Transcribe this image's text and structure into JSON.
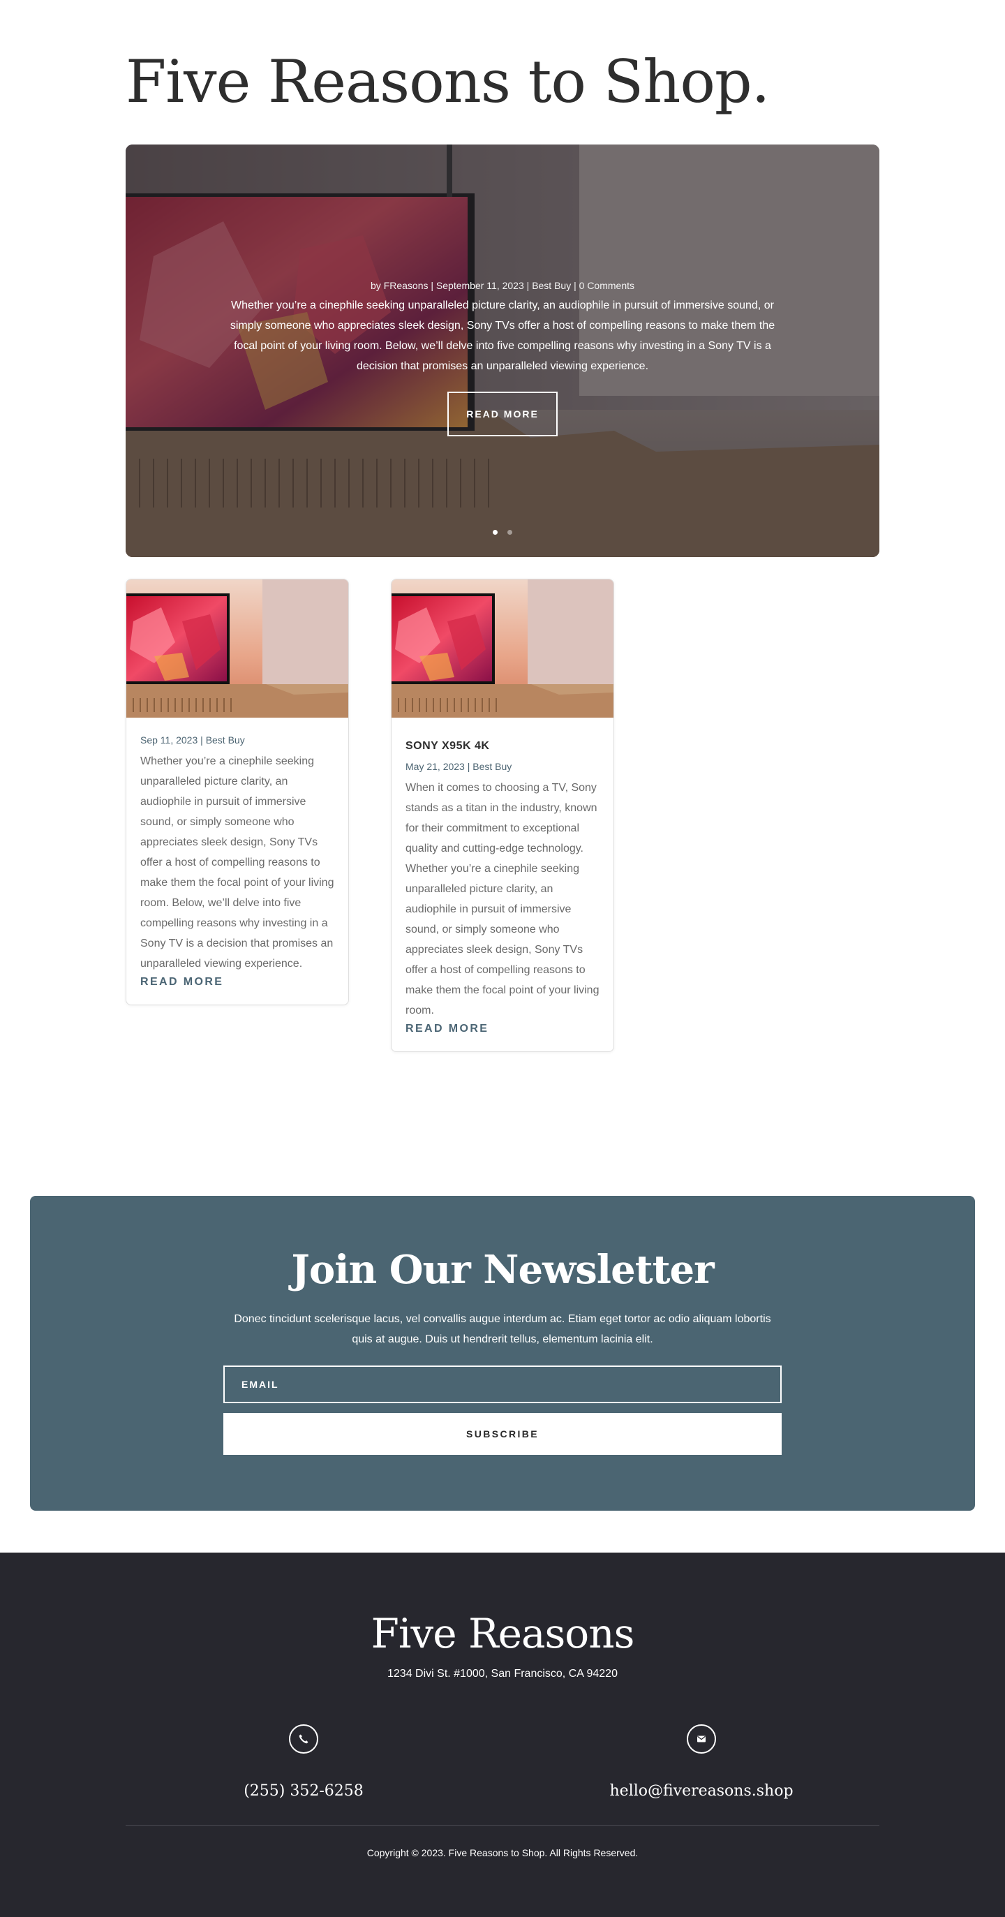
{
  "page": {
    "title": "Five Reasons to Shop."
  },
  "hero": {
    "meta": {
      "by": "by",
      "author": "FReasons",
      "date": "September 11, 2023",
      "category": "Best Buy",
      "comments": "0 Comments",
      "separator": "|"
    },
    "excerpt": "Whether you’re a cinephile seeking unparalleled picture clarity, an audiophile in pursuit of immersive sound, or simply someone who appreciates sleek design, Sony TVs offer a host of compelling reasons to make them the focal point of your living room. Below, we’ll delve into five compelling reasons why investing in a Sony TV is a decision that promises an unparalleled viewing experience.",
    "button": "READ MORE",
    "slides_total": 2,
    "active_slide": 1
  },
  "cards": [
    {
      "title": "",
      "date": "Sep 11, 2023",
      "category": "Best Buy",
      "separator": "|",
      "excerpt": "Whether you’re a cinephile seeking unparalleled picture clarity, an audiophile in pursuit of immersive sound, or simply someone who appreciates sleek design, Sony TVs offer a host of compelling reasons to make them the focal point of your living room. Below, we’ll delve into five compelling reasons why investing in a Sony TV is a decision that promises an unparalleled viewing experience.",
      "link": "READ MORE"
    },
    {
      "title": "SONY X95K 4K",
      "date": "May 21, 2023",
      "category": "Best Buy",
      "separator": "|",
      "excerpt": "When it comes to choosing a TV, Sony stands as a titan in the industry, known for their commitment to exceptional quality and cutting-edge technology. Whether you’re a cinephile seeking unparalleled picture clarity, an audiophile in pursuit of immersive sound, or simply someone who appreciates sleek design, Sony TVs offer a host of compelling reasons to make them the focal point of your living room.",
      "link": "READ MORE"
    }
  ],
  "newsletter": {
    "title": "Join Our Newsletter",
    "text": "Donec tincidunt scelerisque lacus, vel convallis augue interdum ac. Etiam eget tortor ac odio aliquam lobortis quis at augue. Duis ut hendrerit tellus, elementum lacinia elit.",
    "email_placeholder": "EMAIL",
    "subscribe": "SUBSCRIBE",
    "bg_color": "#4b6572"
  },
  "footer": {
    "brand": "Five Reasons",
    "address": "1234 Divi St. #1000, San Francisco, CA 94220",
    "phone_icon": "phone-icon",
    "phone": "(255) 352-6258",
    "email_icon": "envelope-icon",
    "email": "hello@fivereasons.shop",
    "copyright": "Copyright © 2023. Five Reasons to Shop. All Rights Reserved.",
    "bg_color": "#27272e"
  }
}
